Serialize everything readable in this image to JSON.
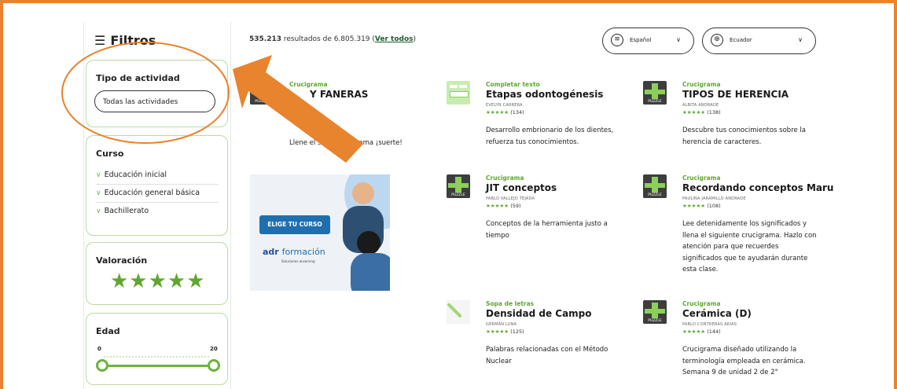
{
  "colors": {
    "frame": "#e8832e",
    "accent_green": "#5fa730",
    "panel_border": "#b8dca0",
    "annotation": "#e8832e"
  },
  "sidebar": {
    "title": "Filtros",
    "title_icon": "sliders-icon",
    "activity": {
      "heading": "Tipo de actividad",
      "select_value": "Todas las actividades"
    },
    "course": {
      "heading": "Curso",
      "items": [
        {
          "label": "Educación inicial"
        },
        {
          "label": "Educación general básica"
        },
        {
          "label": "Bachillerato"
        }
      ]
    },
    "rating": {
      "heading": "Valoración",
      "stars": "★★★★★",
      "value": 5
    },
    "age": {
      "heading": "Edad",
      "min_label": "0",
      "max_label": "20",
      "min_value": 0,
      "max_value": 20
    }
  },
  "results": {
    "count": "535.213",
    "text_mid": " resultados de 6.805.319 (",
    "see_all": "Ver todos",
    "text_end": ")"
  },
  "filters_top": {
    "language": {
      "value": "Español",
      "icon": "language-bubble-icon"
    },
    "country": {
      "value": "Ecuador",
      "icon": "globe-icon"
    }
  },
  "cards": [
    {
      "type": "Crucigrama",
      "title": "Y FANERAS",
      "author": "",
      "stars": "★★★★★",
      "count": "",
      "desc": "Llene el sig... crucigrama ¡suerte!",
      "thumb": "crossword-puzzle-icon"
    },
    {
      "type": "Completar texto",
      "title": "Etapas odontogénesis",
      "author": "EVELYN CARRERA",
      "stars": "★★★★★",
      "count": "(134)",
      "desc": "Desarrollo embrionario de los dientes, refuerza tus conocimientos.",
      "thumb": "fill-text-icon"
    },
    {
      "type": "Crucigrama",
      "title": "TIPOS DE HERENCIA",
      "author": "ALBITA ANDRADE",
      "stars": "★★★★★",
      "count": "(138)",
      "desc": "Descubre tus conocimientos sobre la herencia de caracteres.",
      "thumb": "crossword-puzzle-icon"
    },
    {
      "type": "Crucigrama",
      "title": "JIT conceptos",
      "author": "PABLO VALLEJO TEJADA",
      "stars": "★★★★★",
      "count": "(59)",
      "desc": "Conceptos de la herramienta justo a tiempo",
      "thumb": "crossword-puzzle-icon"
    },
    {
      "type": "Crucigrama",
      "title": "Recordando conceptos Maru",
      "author": "PAULINA JARAMILLO ANDRADE",
      "stars": "★★★★★",
      "count": "(108)",
      "desc": "Lee detenidamente los significados y llena el siguiente crucigrama. Hazlo con atención para que recuerdes significados que te ayudarán durante esta clase.",
      "thumb": "crossword-puzzle-icon"
    },
    {
      "type": "Sopa de letras",
      "title": "Densidad de Campo",
      "author": "GERMÁN LUNA",
      "stars": "★★★★★",
      "count": "(125)",
      "desc": "Palabras relacionadas con el Método Nuclear",
      "thumb": "word-search-icon"
    },
    {
      "type": "Crucigrama",
      "title": "Cerámica (D)",
      "author": "PABLO CONTRERAS ARIAS",
      "stars": "★★★★★",
      "count": "(144)",
      "desc": "Crucigrama diseñado utilizando la terminología empleada en cerámica. Semana 9 de unidad 2 de 2°",
      "thumb": "crossword-puzzle-icon"
    }
  ],
  "ad": {
    "cta": "ELIGE TU CURSO",
    "brand_a": "adr",
    "brand_b": "formación",
    "sub": "Soluciones eLearning"
  }
}
